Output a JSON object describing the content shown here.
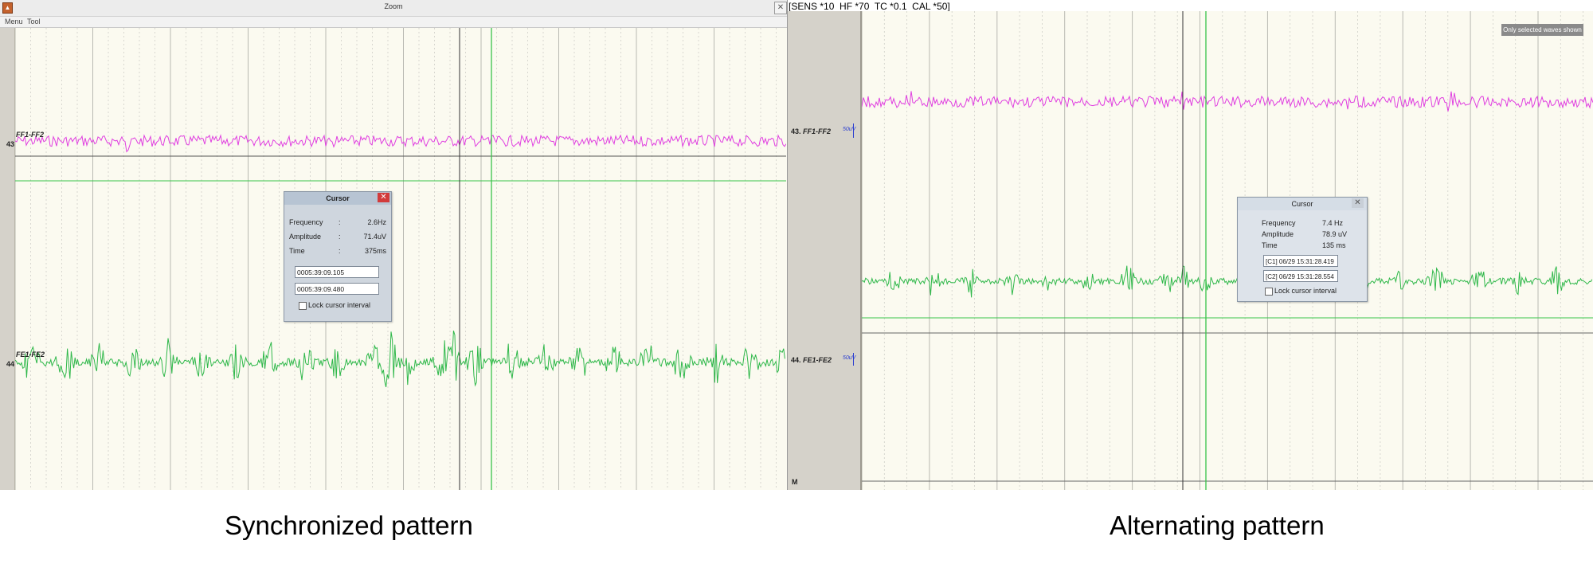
{
  "left_panel": {
    "window_title": "Zoom",
    "app_icon": "app-icon",
    "menu": [
      "Menu",
      "Tool"
    ],
    "channels": [
      {
        "label": "FF1-FF2",
        "number": "43",
        "color": "#e03ee0"
      },
      {
        "label": "FE1-FE2",
        "number": "44",
        "color": "#2fb84a"
      }
    ],
    "cursor_dialog": {
      "title": "Cursor",
      "rows": [
        {
          "label": "Frequency",
          "sep": ":",
          "value": "2.6Hz"
        },
        {
          "label": "Amplitude",
          "sep": ":",
          "value": "71.4uV"
        },
        {
          "label": "Time",
          "sep": ":",
          "value": "375ms"
        }
      ],
      "start_time": "0005:39:09.105",
      "end_time": "0005:39:09.480",
      "lock_label": "Lock cursor interval"
    }
  },
  "right_panel": {
    "header": "[SENS *10  HF *70  TC *0.1  CAL *50]",
    "badge": "Only selected waves shown",
    "channels": [
      {
        "label": "FF1-FF2",
        "number": "43.",
        "sens_mark": "50uV",
        "color": "#e03ee0"
      },
      {
        "label": "FE1-FE2",
        "number": "44.",
        "sens_mark": "50uV",
        "color": "#2fb84a"
      }
    ],
    "footer_marker": "M",
    "cursor_dialog": {
      "title": "Cursor",
      "rows": [
        {
          "label": "Frequency",
          "value": "7.4 Hz"
        },
        {
          "label": "Amplitude",
          "value": "78.9 uV"
        },
        {
          "label": "Time",
          "value": "135 ms"
        }
      ],
      "c1": "[C1] 06/29 15:31:28.419",
      "c2": "[C2] 06/29 15:31:28.554",
      "lock_label": "Lock cursor interval"
    }
  },
  "captions": {
    "left": "Synchronized pattern",
    "right": "Alternating pattern"
  },
  "colors": {
    "magenta_trace": "#e03ee0",
    "green_trace": "#2fb84a",
    "cursor_green": "#39c44a",
    "plot_bg": "#fbfaf0",
    "gutter_bg": "#d5d2ca"
  }
}
